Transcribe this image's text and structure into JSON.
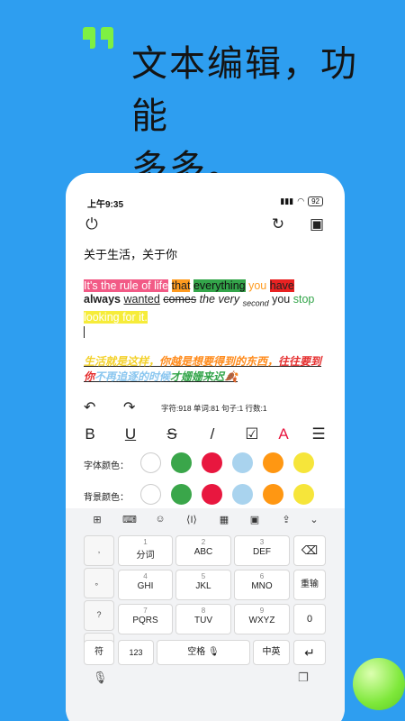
{
  "headline": {
    "line1": "文本编辑，功能",
    "line2": "多多。"
  },
  "status": {
    "time": "上午9:35",
    "signal": "▮▮▮",
    "wifi": "◠",
    "battery": "92"
  },
  "doc": {
    "title": "关于生活，关于你"
  },
  "content": {
    "w1": "It's the rule of life",
    "w2": "that",
    "w3": "everything",
    "w4": "you",
    "w5": "have",
    "w6": "always",
    "w7": "wanted",
    "w8": "comes",
    "w9": "the very",
    "w10": "second",
    "w11": "you",
    "w12": "stop",
    "w13": "looking for it.",
    "cn1": "生活就是这样，",
    "cn2": "你越是想要得到的东西，",
    "cn3": "往往要到你",
    "cn4": "不再追逐的时候",
    "cn5": "才姗姗来迟",
    "cn6": "🍂"
  },
  "stats": "字符:918 单词:81 句子:1 行数:1",
  "format": {
    "bold": "B",
    "underline": "U",
    "strike": "S",
    "italic": "/",
    "check": "☑",
    "textcolor": "A",
    "align": "☰"
  },
  "labels": {
    "font_color": "字体颜色：",
    "bg_color": "背景颜色："
  },
  "colors": [
    "#ffffff",
    "#3aa64a",
    "#e8173f",
    "#a9d3ee",
    "#ff9712",
    "#f6e53a"
  ],
  "keyboard": {
    "tools": [
      "⊞",
      "⌨",
      "☺",
      "⟨I⟩",
      "▦",
      "▣",
      "⇪",
      "⌄"
    ],
    "side": [
      ",",
      "。",
      "?",
      "!"
    ],
    "rows": [
      [
        {
          "n": "1",
          "l": "分词"
        },
        {
          "n": "2",
          "l": "ABC"
        },
        {
          "n": "3",
          "l": "DEF"
        }
      ],
      [
        {
          "n": "4",
          "l": "GHI"
        },
        {
          "n": "5",
          "l": "JKL"
        },
        {
          "n": "6",
          "l": "MNO"
        }
      ],
      [
        {
          "n": "7",
          "l": "PQRS"
        },
        {
          "n": "8",
          "l": "TUV"
        },
        {
          "n": "9",
          "l": "WXYZ"
        }
      ]
    ],
    "right": [
      "⌫",
      "重输",
      "0",
      "↵"
    ],
    "bottom": {
      "sym": "符",
      "num": "123",
      "space": "空格 🎙",
      "lang": "中英"
    }
  }
}
